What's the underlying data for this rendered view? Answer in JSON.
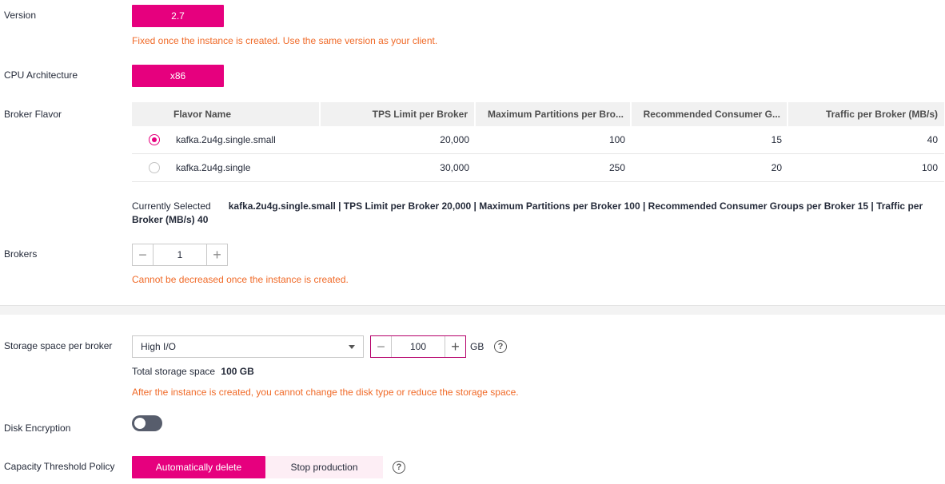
{
  "version": {
    "label": "Version",
    "value": "2.7",
    "hint": "Fixed once the instance is created. Use the same version as your client."
  },
  "cpu": {
    "label": "CPU Architecture",
    "value": "x86"
  },
  "flavor": {
    "label": "Broker Flavor",
    "columns": [
      "Flavor Name",
      "TPS Limit per Broker",
      "Maximum Partitions per Bro...",
      "Recommended Consumer G...",
      "Traffic per Broker (MB/s)"
    ],
    "rows": [
      {
        "selected": true,
        "name": "kafka.2u4g.single.small",
        "tps": "20,000",
        "partitions": "100",
        "consumers": "15",
        "traffic": "40"
      },
      {
        "selected": false,
        "name": "kafka.2u4g.single",
        "tps": "30,000",
        "partitions": "250",
        "consumers": "20",
        "traffic": "100"
      }
    ],
    "current_label": "Currently Selected",
    "current_value_line1": "kafka.2u4g.single.small | TPS Limit per Broker 20,000 | Maximum Partitions per Broker 100 | Recommended Consumer Groups per Broker 15 | Traffic per",
    "current_value_line2": "Broker (MB/s) 40"
  },
  "brokers": {
    "label": "Brokers",
    "value": "1",
    "hint": "Cannot be decreased once the instance is created."
  },
  "storage": {
    "label": "Storage space per broker",
    "disk_type": "High I/O",
    "size": "100",
    "unit": "GB",
    "total_label": "Total storage space",
    "total_value": "100 GB",
    "hint": "After the instance is created, you cannot change the disk type or reduce the storage space."
  },
  "encryption": {
    "label": "Disk Encryption",
    "enabled": false
  },
  "capacity": {
    "label": "Capacity Threshold Policy",
    "options": [
      "Automatically delete",
      "Stop production"
    ],
    "selected": "Automatically delete"
  },
  "colors": {
    "accent": "#e6007e",
    "hint": "#f06a28"
  },
  "icons": {
    "minus": "minus-icon",
    "plus": "plus-icon",
    "help": "question-circle-icon",
    "caret": "caret-down-icon"
  }
}
